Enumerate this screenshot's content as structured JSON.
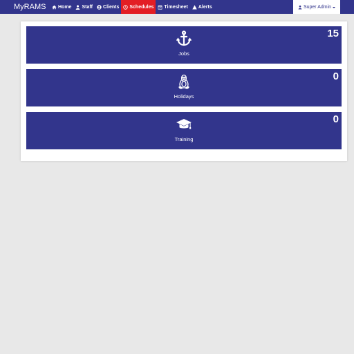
{
  "navbar": {
    "brand": "MyRAMS",
    "items": [
      {
        "label": "Home",
        "icon": "home-icon"
      },
      {
        "label": "Staff",
        "icon": "user-icon"
      },
      {
        "label": "Clients",
        "icon": "user-circle-icon"
      },
      {
        "label": "Schedules",
        "icon": "clock-icon",
        "active": true
      },
      {
        "label": "Timesheet",
        "icon": "calendar-check-icon"
      },
      {
        "label": "Alerts",
        "icon": "warning-icon"
      }
    ],
    "user": {
      "label": "Super Admin",
      "icon": "user-icon"
    }
  },
  "tiles": [
    {
      "label": "Jobs",
      "count": "15",
      "icon": "anchor-icon"
    },
    {
      "label": "Holidays",
      "count": "0",
      "icon": "linux-tux-icon"
    },
    {
      "label": "Training",
      "count": "0",
      "icon": "graduation-cap-icon"
    }
  ],
  "colors": {
    "primary": "#32358c",
    "active_nav": "#e31e24",
    "background": "#e8e8e8"
  }
}
